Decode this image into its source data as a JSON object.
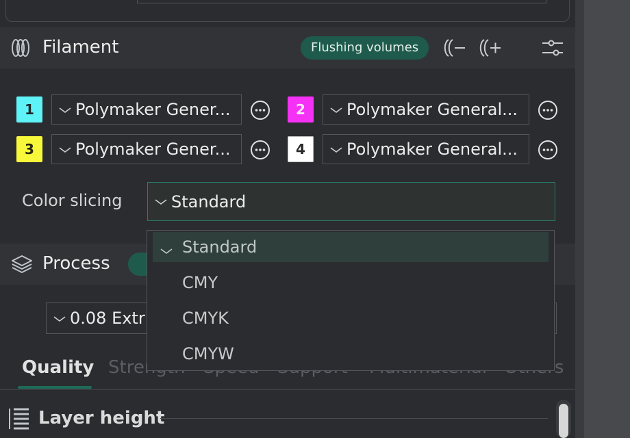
{
  "filament": {
    "title": "Filament",
    "flushing_label": "Flushing volumes",
    "slots": [
      {
        "num": "1",
        "color": "#5ef3f7",
        "name": "Polymaker Gener..."
      },
      {
        "num": "2",
        "color": "#f531f5",
        "name": "Polymaker General..."
      },
      {
        "num": "3",
        "color": "#f8f83a",
        "name": "Polymaker Gener..."
      },
      {
        "num": "4",
        "color": "#ffffff",
        "name": "Polymaker General..."
      }
    ],
    "color_slicing_label": "Color slicing",
    "color_slicing_value": "Standard",
    "options": [
      "Standard",
      "CMY",
      "CMYK",
      "CMYW"
    ]
  },
  "process": {
    "title": "Process",
    "preset_value": "0.08 Extr"
  },
  "tabs": [
    "Quality",
    "Strength",
    "Speed",
    "Support",
    "Multimaterial",
    "Others"
  ],
  "section": {
    "title": "Layer height"
  }
}
